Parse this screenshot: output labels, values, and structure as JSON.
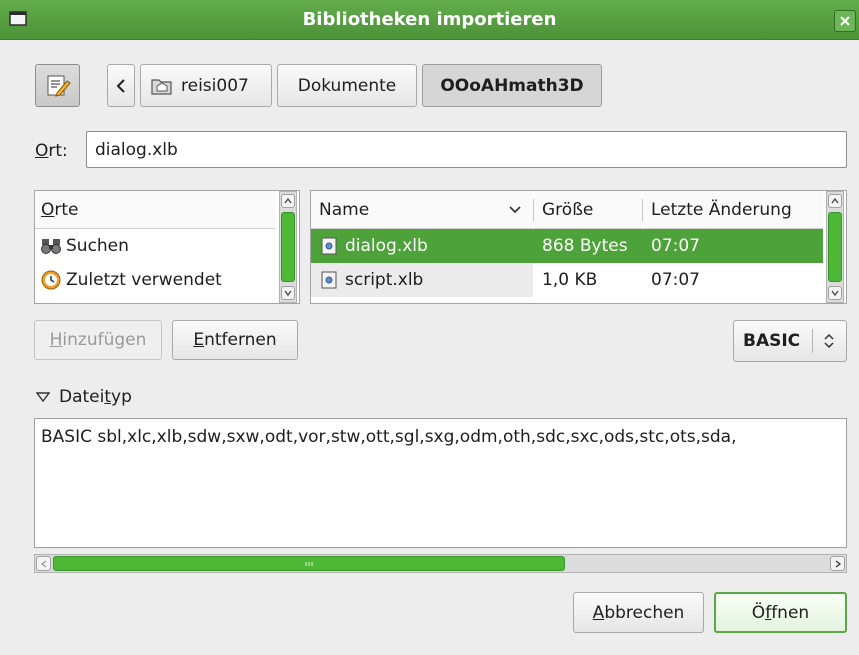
{
  "window": {
    "title": "Bibliotheken importieren",
    "accent": "#4ea23a"
  },
  "breadcrumbs": [
    {
      "label": "reisi007"
    },
    {
      "label": "Dokumente"
    },
    {
      "label": "OOoAHmath3D"
    }
  ],
  "location": {
    "label_u": "O",
    "label_rest": "rt:",
    "value": "dialog.xlb"
  },
  "places": {
    "header_u": "O",
    "header_rest": "rte",
    "items": [
      {
        "label": "Suchen",
        "icon": "binoculars-icon"
      },
      {
        "label": "Zuletzt verwendet",
        "icon": "recent-icon"
      }
    ]
  },
  "files": {
    "columns": {
      "name": "Name",
      "size": "Größe",
      "modified": "Letzte Änderung"
    },
    "rows": [
      {
        "name": "dialog.xlb",
        "size": "868 Bytes",
        "modified": "07:07",
        "selected": true
      },
      {
        "name": "script.xlb",
        "size": "1,0 KB",
        "modified": "07:07",
        "selected": false
      }
    ]
  },
  "actions": {
    "add_u": "H",
    "add_rest": "inzufügen",
    "remove_u": "E",
    "remove_rest": "ntfernen"
  },
  "filter": {
    "selected": "BASIC"
  },
  "filetype": {
    "expander_pre": "Datei",
    "expander_u": "t",
    "expander_post": "yp",
    "text": "BASIC  sbl,xlc,xlb,sdw,sxw,odt,vor,stw,ott,sgl,sxg,odm,oth,sdc,sxc,ods,stc,ots,sda,",
    "scroll_position": 0.0,
    "scroll_visible_fraction": 0.66
  },
  "buttons": {
    "cancel_u": "A",
    "cancel_rest": "bbrechen",
    "open_pre": "Ö",
    "open_u": "f",
    "open_post": "fnen"
  }
}
